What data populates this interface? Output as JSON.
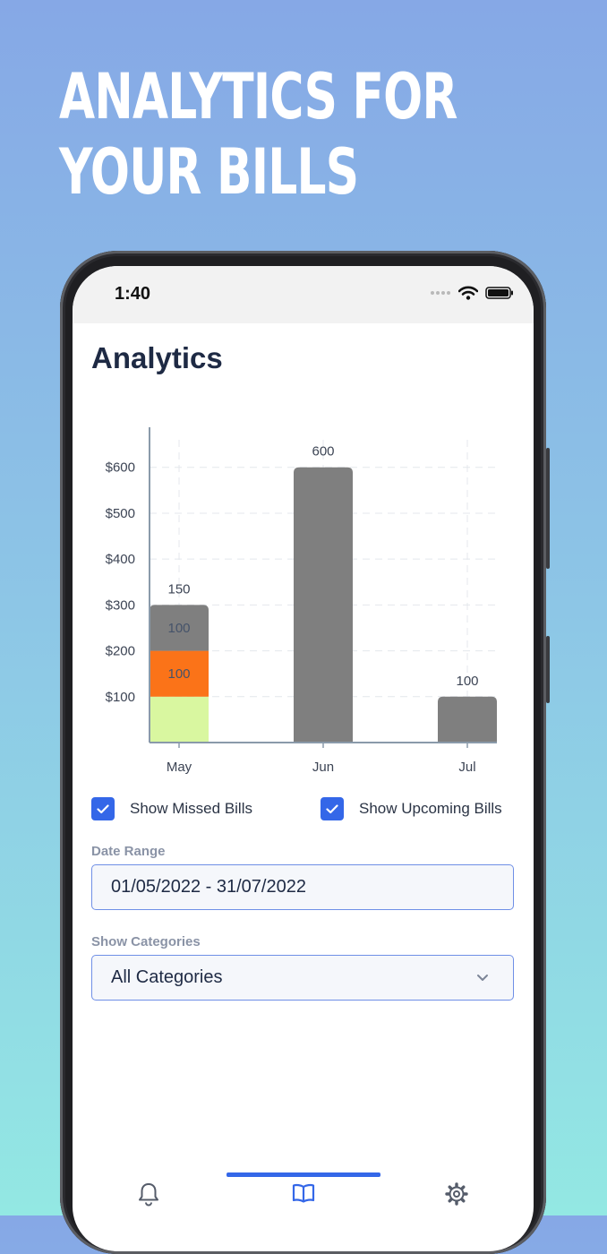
{
  "promo": {
    "headline_line1": "ANALYTICS FOR",
    "headline_line2": "YOUR BILLS"
  },
  "status_bar": {
    "time": "1:40",
    "icons": [
      "signal-dots-icon",
      "wifi-icon",
      "battery-icon"
    ]
  },
  "page": {
    "title": "Analytics"
  },
  "chart_data": {
    "type": "bar",
    "stacked": true,
    "categories": [
      "May",
      "Jun",
      "Jul"
    ],
    "series": [
      {
        "values": [
          100,
          0,
          0
        ],
        "color": "#d9f7a0"
      },
      {
        "values": [
          100,
          0,
          0
        ],
        "color": "#fb7318"
      },
      {
        "values": [
          100,
          600,
          100
        ],
        "color": "#7f7f7f"
      }
    ],
    "segment_labels": [
      {
        "category": "May",
        "text": "100",
        "level": 150
      },
      {
        "category": "May",
        "text": "100",
        "level": 250
      }
    ],
    "totals_labels": [
      "150",
      "600",
      "100"
    ],
    "ylim": [
      0,
      660
    ],
    "yticks": [
      100,
      200,
      300,
      400,
      500,
      600
    ],
    "ytick_labels": [
      "$100",
      "$200",
      "$300",
      "$400",
      "$500",
      "$600"
    ],
    "grid": true
  },
  "filters": {
    "missed": {
      "label": "Show Missed Bills",
      "checked": true
    },
    "upcoming": {
      "label": "Show Upcoming Bills",
      "checked": true
    },
    "date_range": {
      "label": "Date Range",
      "value": "01/05/2022 - 31/07/2022"
    },
    "categories": {
      "label": "Show Categories",
      "value": "All Categories"
    }
  },
  "tabs": [
    {
      "icon": "bell-icon",
      "active": false
    },
    {
      "icon": "book-icon",
      "active": true
    },
    {
      "icon": "gear-icon",
      "active": false
    }
  ],
  "colors": {
    "accent": "#3467e8",
    "title": "#1e2a44",
    "bar_gray": "#7f7f7f",
    "bar_orange": "#fb7318",
    "bar_green": "#d9f7a0"
  }
}
